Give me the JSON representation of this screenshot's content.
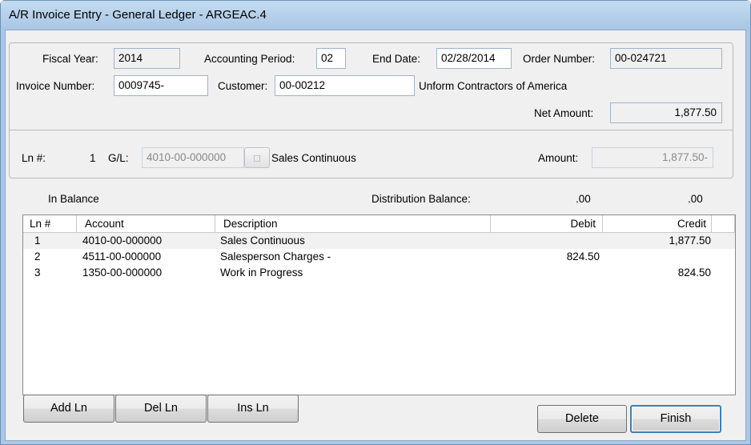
{
  "window": {
    "title": "A/R Invoice Entry - General Ledger - ARGEAC.4"
  },
  "header": {
    "fiscal_year_label": "Fiscal Year:",
    "fiscal_year": "2014",
    "period_label": "Accounting Period:",
    "period": "02",
    "end_date_label": "End Date:",
    "end_date": "02/28/2014",
    "order_label": "Order Number:",
    "order": "00-024721",
    "invoice_label": "Invoice Number:",
    "invoice": "0009745-",
    "customer_label": "Customer:",
    "customer": "00-00212",
    "customer_name": "Unform Contractors of America",
    "net_label": "Net Amount:",
    "net": "1,877.50"
  },
  "line": {
    "ln_label": "Ln #:",
    "ln": "1",
    "gl_label": "G/L:",
    "gl": "4010-00-000000",
    "lookup_icon": "lookup-icon",
    "gl_desc": "Sales Continuous",
    "amount_label": "Amount:",
    "amount": "1,877.50-"
  },
  "balance": {
    "status": "In Balance",
    "label": "Distribution Balance:",
    "debit": ".00",
    "credit": ".00"
  },
  "grid": {
    "columns": [
      "Ln #",
      "Account",
      "Description",
      "Debit",
      "Credit"
    ],
    "rows": [
      {
        "ln": "1",
        "account": "4010-00-000000",
        "description": "Sales Continuous",
        "debit": "",
        "credit": "1,877.50"
      },
      {
        "ln": "2",
        "account": "4511-00-000000",
        "description": "Salesperson Charges -",
        "debit": "824.50",
        "credit": ""
      },
      {
        "ln": "3",
        "account": "1350-00-000000",
        "description": "Work in Progress",
        "debit": "",
        "credit": "824.50"
      }
    ]
  },
  "buttons": {
    "add": "Add Ln",
    "del": "Del Ln",
    "ins": "Ins Ln",
    "delete": "Delete",
    "finish": "Finish"
  },
  "colors": {
    "title_bar": "#aac8e6",
    "dialog_bg": "#f0f0f0",
    "default_button_border": "#3c7fb1"
  }
}
